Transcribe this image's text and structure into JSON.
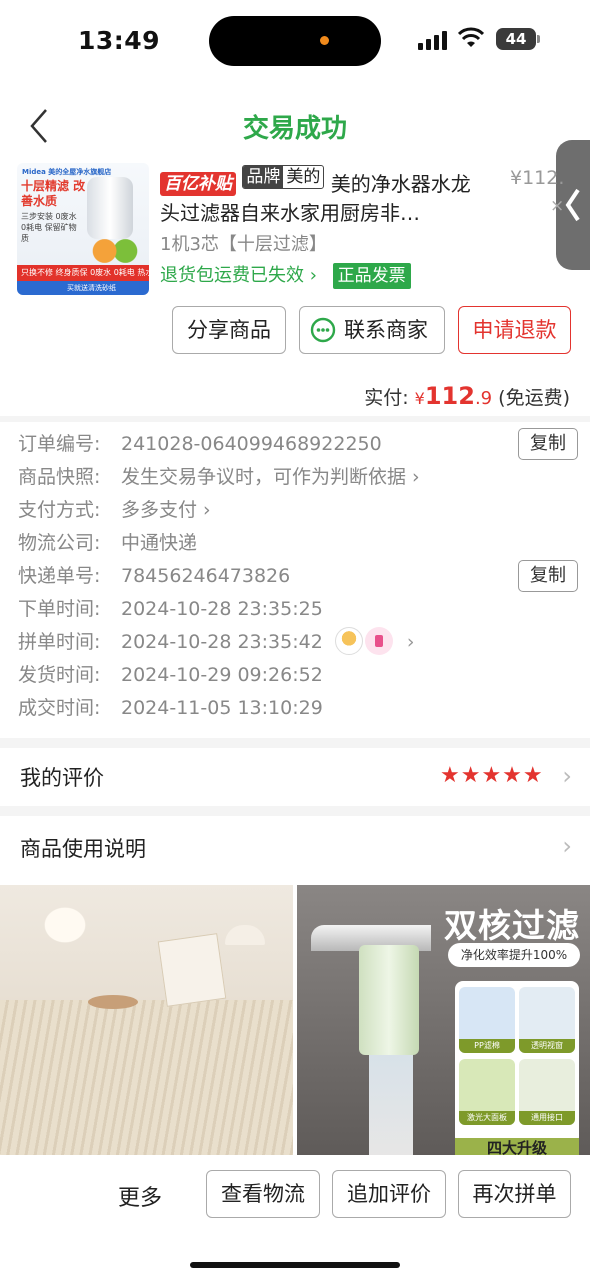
{
  "status_bar": {
    "time": "13:49",
    "battery": "44"
  },
  "nav": {
    "title": "交易成功"
  },
  "product": {
    "thumb_brand": "Midea 美的全屋净水旗舰店",
    "thumb_headline": "十层精滤 改善水质",
    "thumb_features": "三步安装 0废水0耗电 保留矿物质",
    "thumb_strip": "只换不修 终身质保  0废水 0耗电 热水可用",
    "thumb_strip2": "买就送清洗砂纸",
    "tag_subsidy": "百亿补贴",
    "tag_brand_label": "品牌",
    "tag_brand_name": "美的",
    "title": "美的净水器水龙头过滤器自来水家用厨房非…",
    "price": "¥112.",
    "qty": "×",
    "spec": "1机3芯【十层过滤】",
    "refund_shipping": "退货包运费已失效 ›",
    "invoice_tag": "正品发票"
  },
  "actions": {
    "share": "分享商品",
    "contact": "联系商家",
    "refund": "申请退款"
  },
  "payment": {
    "label": "实付:",
    "currency": "¥",
    "amount_int": "112",
    "amount_dec": ".9",
    "shipping_note": "(免运费)"
  },
  "order_info": {
    "rows": [
      {
        "label": "订单编号:",
        "value": "241028-064099468922250",
        "action": "复制"
      },
      {
        "label": "商品快照:",
        "value": "发生交易争议时，可作为判断依据 ›"
      },
      {
        "label": "支付方式:",
        "value": "多多支付 ›"
      },
      {
        "label": "物流公司:",
        "value": "中通快递"
      },
      {
        "label": "快递单号:",
        "value": "78456246473826",
        "action": "复制"
      },
      {
        "label": "下单时间:",
        "value": "2024-10-28 23:35:25"
      },
      {
        "label": "拼单时间:",
        "value": "2024-10-28 23:35:42"
      },
      {
        "label": "发货时间:",
        "value": "2024-10-29 09:26:52"
      },
      {
        "label": "成交时间:",
        "value": "2024-11-05 13:10:29"
      }
    ]
  },
  "review": {
    "label": "我的评价",
    "stars": "★★★★★",
    "rating": 5
  },
  "manual": {
    "label": "商品使用说明"
  },
  "feed": {
    "img2_title": "双核过滤",
    "img2_subtitle": "净化效率提升100%",
    "img2_cells": [
      "PP滤棉",
      "透明视窗",
      "激光大面板",
      "通用接口"
    ],
    "img2_bottom": "四大升级"
  },
  "bottom_bar": {
    "more": "更多",
    "logistics": "查看物流",
    "add_review": "追加评价",
    "regroup": "再次拼单"
  },
  "colors": {
    "accent_green": "#2ea84a",
    "accent_red": "#e3342f"
  }
}
